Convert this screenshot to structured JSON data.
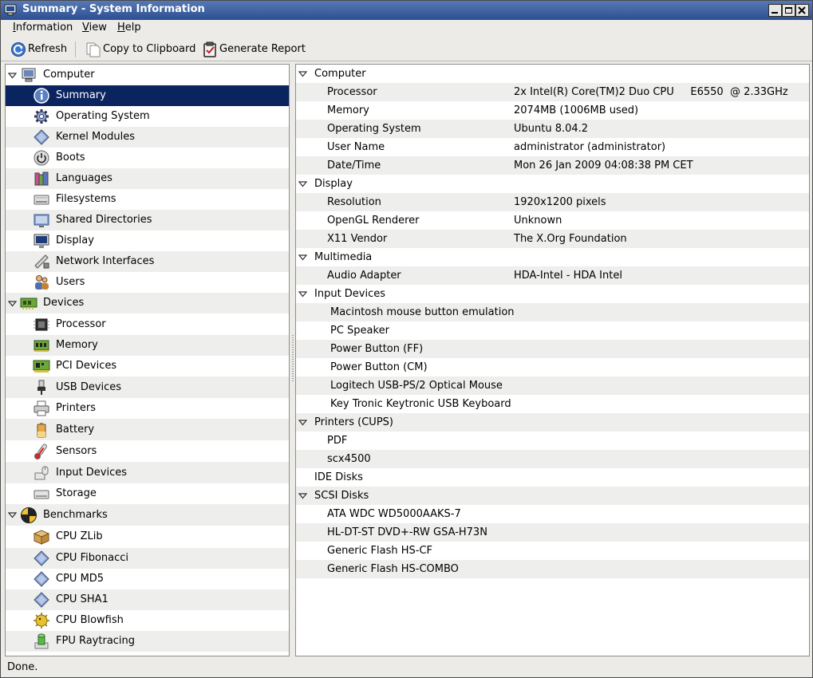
{
  "window": {
    "title": "Summary - System Information"
  },
  "menubar": {
    "items": [
      {
        "label": "Information",
        "mnemonic": "I",
        "rest": "nformation"
      },
      {
        "label": "View",
        "mnemonic": "V",
        "rest": "iew"
      },
      {
        "label": "Help",
        "mnemonic": "H",
        "rest": "elp"
      }
    ]
  },
  "toolbar": {
    "refresh_label": "Refresh",
    "copy_label": "Copy to Clipboard",
    "report_label": "Generate Report"
  },
  "tree": [
    {
      "label": "Computer",
      "level": 0,
      "expanded": true,
      "icon": "computer-icon"
    },
    {
      "label": "Summary",
      "level": 1,
      "selected": true,
      "icon": "info-icon"
    },
    {
      "label": "Operating System",
      "level": 1,
      "icon": "gear-icon"
    },
    {
      "label": "Kernel Modules",
      "level": 1,
      "icon": "module-icon"
    },
    {
      "label": "Boots",
      "level": 1,
      "icon": "power-icon"
    },
    {
      "label": "Languages",
      "level": 1,
      "icon": "books-icon"
    },
    {
      "label": "Filesystems",
      "level": 1,
      "icon": "drive-icon"
    },
    {
      "label": "Shared Directories",
      "level": 1,
      "icon": "shared-folder-icon"
    },
    {
      "label": "Display",
      "level": 1,
      "icon": "monitor-icon"
    },
    {
      "label": "Network Interfaces",
      "level": 1,
      "icon": "network-icon"
    },
    {
      "label": "Users",
      "level": 1,
      "icon": "users-icon"
    },
    {
      "label": "Devices",
      "level": 0,
      "expanded": true,
      "icon": "devices-icon"
    },
    {
      "label": "Processor",
      "level": 1,
      "icon": "cpu-icon"
    },
    {
      "label": "Memory",
      "level": 1,
      "icon": "memory-icon"
    },
    {
      "label": "PCI Devices",
      "level": 1,
      "icon": "pci-icon"
    },
    {
      "label": "USB Devices",
      "level": 1,
      "icon": "usb-icon"
    },
    {
      "label": "Printers",
      "level": 1,
      "icon": "printer-icon"
    },
    {
      "label": "Battery",
      "level": 1,
      "icon": "battery-icon"
    },
    {
      "label": "Sensors",
      "level": 1,
      "icon": "thermometer-icon"
    },
    {
      "label": "Input Devices",
      "level": 1,
      "icon": "input-devices-icon"
    },
    {
      "label": "Storage",
      "level": 1,
      "icon": "storage-icon"
    },
    {
      "label": "Benchmarks",
      "level": 0,
      "expanded": true,
      "icon": "benchmark-icon"
    },
    {
      "label": "CPU ZLib",
      "level": 1,
      "icon": "box-icon"
    },
    {
      "label": "CPU Fibonacci",
      "level": 1,
      "icon": "module-icon"
    },
    {
      "label": "CPU MD5",
      "level": 1,
      "icon": "module-icon"
    },
    {
      "label": "CPU SHA1",
      "level": 1,
      "icon": "module-icon"
    },
    {
      "label": "CPU Blowfish",
      "level": 1,
      "icon": "blowfish-icon"
    },
    {
      "label": "FPU Raytracing",
      "level": 1,
      "icon": "raytracing-icon"
    }
  ],
  "summary": [
    {
      "type": "section",
      "label": "Computer",
      "expander": true
    },
    {
      "type": "item",
      "key": "Processor",
      "value": "2x Intel(R) Core(TM)2 Duo CPU     E6550  @ 2.33GHz"
    },
    {
      "type": "item",
      "key": "Memory",
      "value": "2074MB (1006MB used)"
    },
    {
      "type": "item",
      "key": "Operating System",
      "value": "Ubuntu 8.04.2"
    },
    {
      "type": "item",
      "key": "User Name",
      "value": "administrator (administrator)"
    },
    {
      "type": "item",
      "key": "Date/Time",
      "value": "Mon 26 Jan 2009 04:08:38 PM CET"
    },
    {
      "type": "section",
      "label": "Display",
      "expander": true
    },
    {
      "type": "item",
      "key": "Resolution",
      "value": "1920x1200 pixels"
    },
    {
      "type": "item",
      "key": "OpenGL Renderer",
      "value": "Unknown"
    },
    {
      "type": "item",
      "key": "X11 Vendor",
      "value": "The X.Org Foundation"
    },
    {
      "type": "section",
      "label": "Multimedia",
      "expander": true
    },
    {
      "type": "item",
      "key": "Audio Adapter",
      "value": "HDA-Intel - HDA Intel"
    },
    {
      "type": "section",
      "label": "Input Devices",
      "expander": true
    },
    {
      "type": "subitem",
      "key": "Macintosh mouse button emulation",
      "value": ""
    },
    {
      "type": "subitem",
      "key": "PC Speaker",
      "value": ""
    },
    {
      "type": "subitem",
      "key": "Power Button (FF)",
      "value": ""
    },
    {
      "type": "subitem",
      "key": "Power Button (CM)",
      "value": ""
    },
    {
      "type": "subitem",
      "key": "Logitech USB-PS/2 Optical Mouse",
      "value": ""
    },
    {
      "type": "subitem",
      "key": "Key Tronic Keytronic USB Keyboard",
      "value": ""
    },
    {
      "type": "section",
      "label": "Printers (CUPS)",
      "expander": true
    },
    {
      "type": "item",
      "key": "PDF",
      "value": ""
    },
    {
      "type": "item",
      "key": "scx4500",
      "value": ""
    },
    {
      "type": "section",
      "label": "IDE Disks",
      "expander": false
    },
    {
      "type": "section",
      "label": "SCSI Disks",
      "expander": true
    },
    {
      "type": "item",
      "key": "ATA WDC WD5000AAKS-7",
      "value": ""
    },
    {
      "type": "item",
      "key": "HL-DT-ST DVD+-RW GSA-H73N",
      "value": ""
    },
    {
      "type": "item",
      "key": "Generic Flash HS-CF",
      "value": ""
    },
    {
      "type": "item",
      "key": "Generic Flash HS-COMBO",
      "value": ""
    }
  ],
  "status": {
    "text": "Done."
  },
  "colors": {
    "title_bar": "#2d4f91",
    "selection": "#0a2460",
    "alt_row": "#eeeeec"
  }
}
